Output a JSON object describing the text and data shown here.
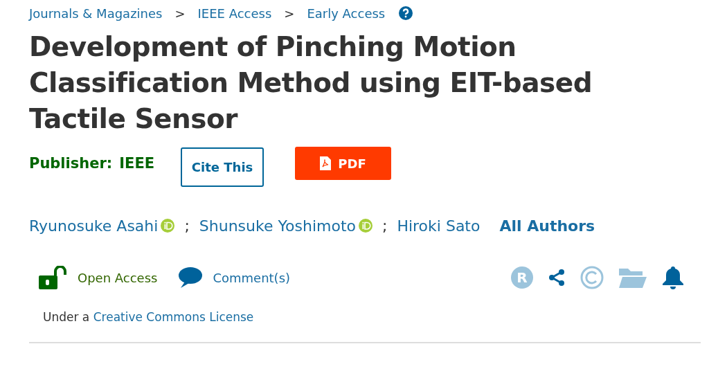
{
  "breadcrumb": [
    "Journals & Magazines",
    "IEEE Access",
    "Early Access"
  ],
  "breadcrumb_separator": ">",
  "title": "Development of Pinching Motion Classification Method using EIT-based Tactile Sensor",
  "publisher": {
    "label": "Publisher:",
    "name": "IEEE"
  },
  "buttons": {
    "cite": "Cite This",
    "pdf": "PDF"
  },
  "authors": [
    {
      "name": "Ryunosuke Asahi",
      "orcid": true
    },
    {
      "name": "Shunsuke Yoshimoto",
      "orcid": true
    },
    {
      "name": "Hiroki Sato",
      "orcid": false
    }
  ],
  "author_separator": ";",
  "all_authors": "All Authors",
  "access": {
    "open_access": "Open Access",
    "comments": "Comment(s)"
  },
  "reprints_icon_text": "R",
  "license": {
    "prefix": "Under a",
    "link": "Creative Commons License"
  }
}
